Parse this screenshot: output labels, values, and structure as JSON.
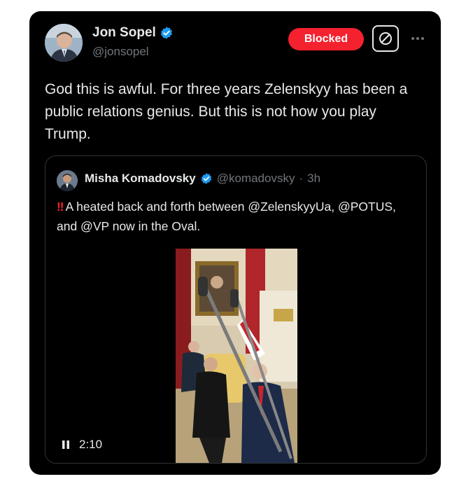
{
  "post": {
    "author_name": "Jon Sopel",
    "author_handle": "@jonsopel",
    "blocked_label": "Blocked",
    "avatar": "profile-photo",
    "text": "God this is awful. For three years Zelenskyy has been a public relations genius. But this is not how you play Trump."
  },
  "quoted_post": {
    "author_name": "Misha Komadovsky",
    "author_handle": "@komadovsky",
    "separator": "·",
    "time": "3h",
    "prefix_emoji": "‼",
    "text": "A heated back and forth between @ZelenskyyUa, @POTUS, and @VP now in the Oval.",
    "video": {
      "duration": "2:10",
      "state": "pause-icon",
      "scene": "oval-office-meeting"
    }
  },
  "colors": {
    "background": "#000000",
    "text": "#e7e9ea",
    "secondary_text": "#71767b",
    "verified_blue": "#1d9bf0",
    "blocked_red": "#f4212e",
    "border": "#2f3336"
  },
  "icons": [
    "verified-badge-icon",
    "block-icon",
    "more-icon",
    "pause-icon"
  ]
}
